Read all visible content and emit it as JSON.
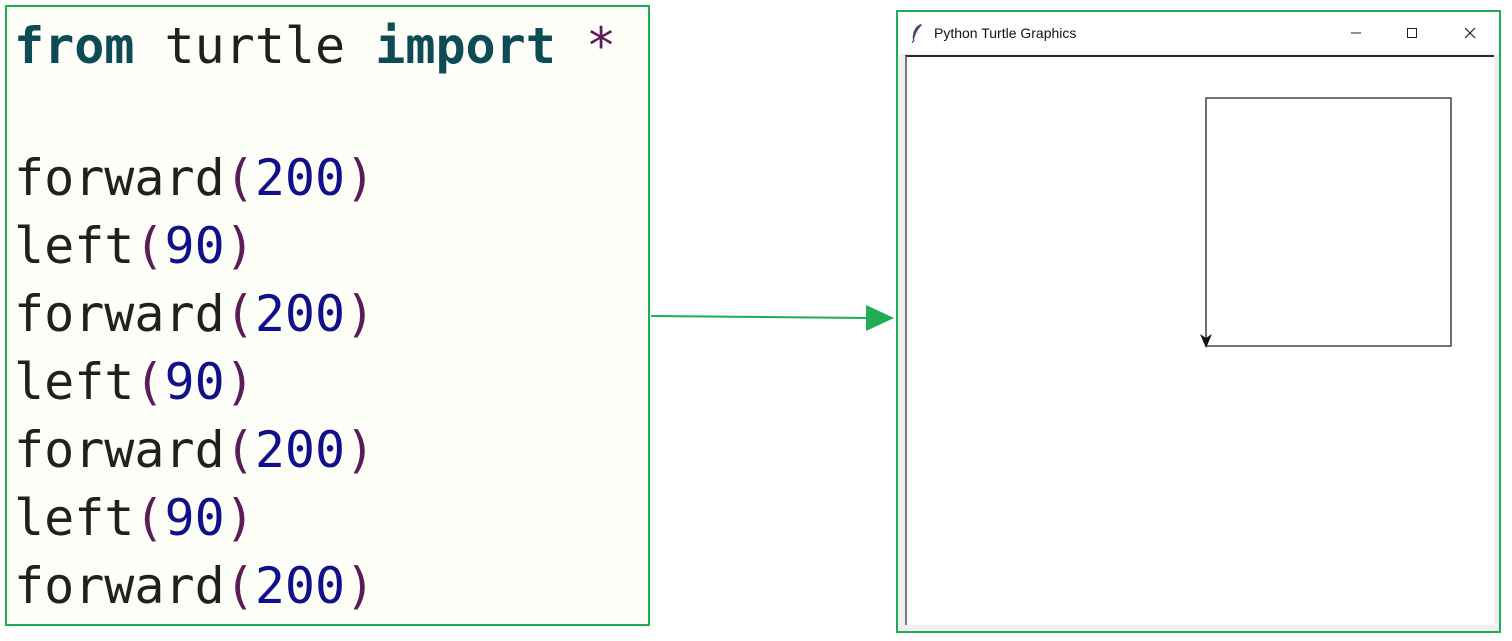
{
  "code": {
    "import_line": {
      "kw_from": "from",
      "module": " turtle ",
      "kw_import": "import",
      "star": " *"
    },
    "commands": [
      {
        "func": "forward",
        "open": "(",
        "arg": "200",
        "close": ")"
      },
      {
        "func": "left",
        "open": "(",
        "arg": "90",
        "close": ")"
      },
      {
        "func": "forward",
        "open": "(",
        "arg": "200",
        "close": ")"
      },
      {
        "func": "left",
        "open": "(",
        "arg": "90",
        "close": ")"
      },
      {
        "func": "forward",
        "open": "(",
        "arg": "200",
        "close": ")"
      },
      {
        "func": "left",
        "open": "(",
        "arg": "90",
        "close": ")"
      },
      {
        "func": "forward",
        "open": "(",
        "arg": "200",
        "close": ")"
      }
    ]
  },
  "window": {
    "title": "Python Turtle Graphics",
    "icons": [
      "feather-icon",
      "minimize-icon",
      "maximize-icon",
      "close-icon"
    ]
  },
  "colors": {
    "accent_green": "#1fad55",
    "keyword": "#0d4b55",
    "number": "#10108a",
    "paren": "#5b1d5a",
    "code_bg": "#fefef8"
  }
}
